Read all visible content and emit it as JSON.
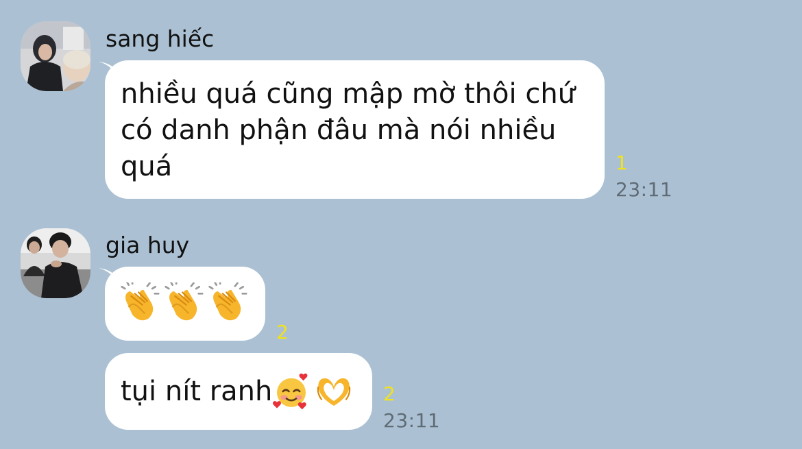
{
  "messages": [
    {
      "sender": "sang hiếc",
      "text": "nhiều quá cũng mập mờ thôi chứ\ncó danh phận đâu mà nói nhiều\nquá",
      "read_count": "1",
      "time": "23:11"
    },
    {
      "sender": "gia huy",
      "emoji_names": [
        "clapping-hands",
        "clapping-hands",
        "clapping-hands"
      ],
      "read_count": "2"
    },
    {
      "text": "tụi nít ranh",
      "emoji_names": [
        "smiling-face-with-hearts",
        "heart-hands"
      ],
      "read_count": "2",
      "time": "23:11"
    }
  ],
  "colors": {
    "background": "#abc1d3",
    "bubble": "#ffffff",
    "read_count": "#f2e21a",
    "timestamp": "#5f6b75"
  }
}
